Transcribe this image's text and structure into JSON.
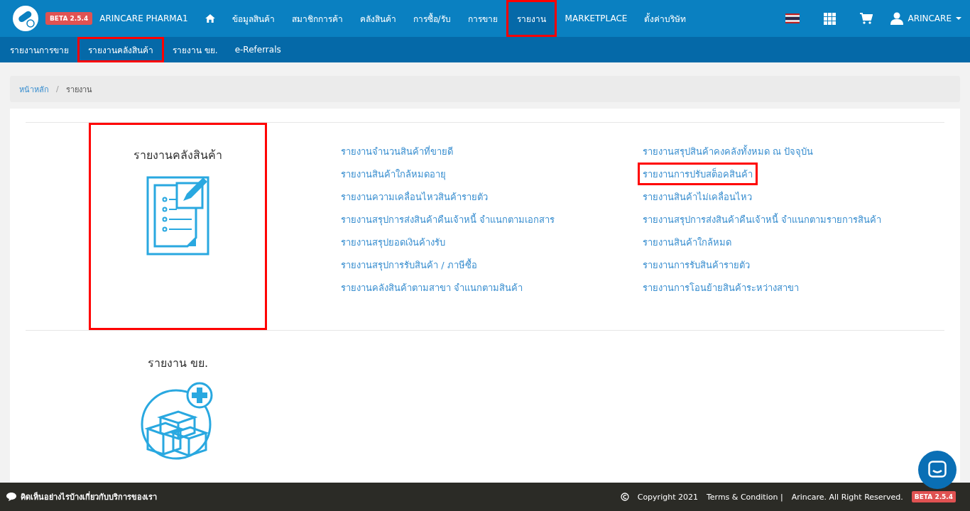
{
  "header": {
    "brand_badge": "BETA 2.5.4",
    "company": "ARINCARE PHARMA1",
    "user": "ARINCARE"
  },
  "nav": [
    {
      "kind": "home",
      "selected": false
    },
    {
      "kind": "text",
      "label": "ข้อมูลสินค้า",
      "selected": false
    },
    {
      "kind": "text",
      "label": "สมาชิกการค้า",
      "selected": false
    },
    {
      "kind": "text",
      "label": "คลังสินค้า",
      "selected": false
    },
    {
      "kind": "text",
      "label": "การซื้อ/รับ",
      "selected": false
    },
    {
      "kind": "text",
      "label": "การขาย",
      "selected": false
    },
    {
      "kind": "text",
      "label": "รายงาน",
      "selected": true
    },
    {
      "kind": "text",
      "label": "MARKETPLACE",
      "selected": false
    },
    {
      "kind": "text",
      "label": "ตั้งค่าบริษัท",
      "selected": false
    }
  ],
  "subnav": [
    {
      "label": "รายงานการขาย",
      "selected": false
    },
    {
      "label": "รายงานคลังสินค้า",
      "selected": true
    },
    {
      "label": "รายงาน ขย.",
      "selected": false
    },
    {
      "label": "e-Referrals",
      "selected": false
    }
  ],
  "breadcrumb": [
    {
      "label": "หน้าหลัก",
      "kind": "link"
    },
    {
      "label": "/",
      "kind": "separator"
    },
    {
      "label": "รายงาน",
      "kind": "current"
    }
  ],
  "sections": [
    {
      "title": "รายงานคลังสินค้า",
      "kind": "document",
      "highlighted": true,
      "columns": [
        [
          {
            "label": "รายงานจำนวนสินค้าที่ขายดี",
            "highlighted": false
          },
          {
            "label": "รายงานสินค้าใกล้หมดอายุ",
            "highlighted": false
          },
          {
            "label": "รายงานความเคลื่อนไหวสินค้ารายตัว",
            "highlighted": false
          },
          {
            "label": "รายงานสรุปการส่งสินค้าคืนเจ้าหนี้ จำแนกตามเอกสาร",
            "highlighted": false
          },
          {
            "label": "รายงานสรุปยอดเงินค้างรับ",
            "highlighted": false
          },
          {
            "label": "รายงานสรุปการรับสินค้า / ภาษีซื้อ",
            "highlighted": false
          },
          {
            "label": "รายงานคลังสินค้าตามสาขา จำแนกตามสินค้า",
            "highlighted": false
          }
        ],
        [
          {
            "label": "รายงานสรุปสินค้าคงคลังทั้งหมด ณ ปัจจุบัน",
            "highlighted": false
          },
          {
            "label": "รายงานการปรับสต็อคสินค้า",
            "highlighted": true
          },
          {
            "label": "รายงานสินค้าไม่เคลื่อนไหว",
            "highlighted": false
          },
          {
            "label": "รายงานสรุปการส่งสินค้าคืนเจ้าหนี้ จำแนกตามรายการสินค้า",
            "highlighted": false
          },
          {
            "label": "รายงานสินค้าใกล้หมด",
            "highlighted": false
          },
          {
            "label": "รายงานการรับสินค้ารายตัว",
            "highlighted": false
          },
          {
            "label": "รายงานการโอนย้ายสินค้าระหว่างสาขา",
            "highlighted": false
          }
        ]
      ]
    },
    {
      "title": "รายงาน ขย.",
      "kind": "boxes",
      "highlighted": false
    }
  ],
  "footer": {
    "feedback": "คิดเห็นอย่างไรบ้างเกี่ยวกับบริการของเรา",
    "copyright": "Copyright 2021",
    "terms": "Terms & Condition |",
    "rights": "Arincare. All Right Reserved.",
    "badge": "BETA 2.5.4"
  }
}
